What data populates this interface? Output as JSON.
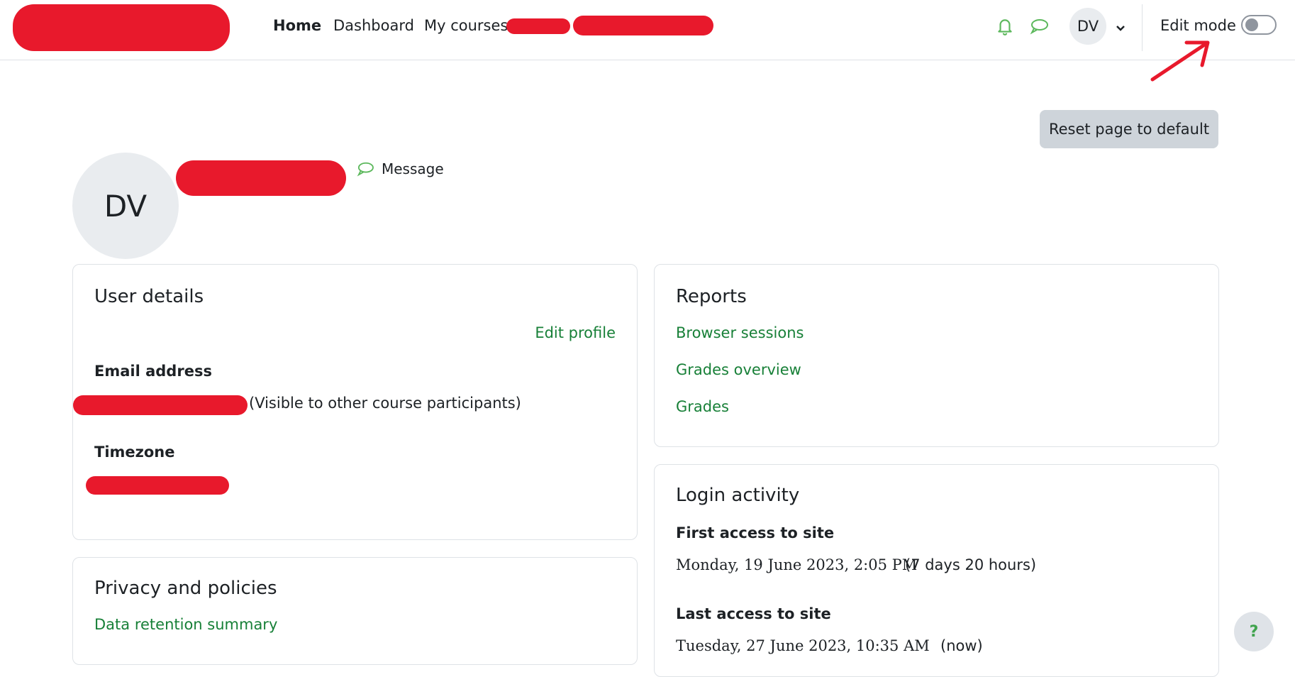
{
  "nav": {
    "items": [
      {
        "label": "Home"
      },
      {
        "label": "Dashboard"
      },
      {
        "label": "My courses"
      }
    ],
    "user_initials": "DV",
    "edit_mode_label": "Edit mode"
  },
  "page": {
    "reset_button": "Reset page to default",
    "avatar_initials": "DV",
    "message_label": "Message"
  },
  "user_details": {
    "title": "User details",
    "edit_profile": "Edit profile",
    "email_label": "Email address",
    "email_note": "(Visible to other course participants)",
    "timezone_label": "Timezone"
  },
  "privacy": {
    "title": "Privacy and policies",
    "link": "Data retention summary"
  },
  "reports": {
    "title": "Reports",
    "links": [
      "Browser sessions",
      "Grades overview",
      "Grades"
    ]
  },
  "login_activity": {
    "title": "Login activity",
    "first_label": "First access to site",
    "first_date": "Monday, 19 June 2023, 2:05 PM",
    "first_rel": "(7 days 20 hours)",
    "last_label": "Last access to site",
    "last_date": "Tuesday, 27 June 2023, 10:35 AM",
    "last_rel": "(now)"
  },
  "help": {
    "label": "?"
  },
  "colors": {
    "link": "#188038",
    "redaction": "#e8192c",
    "accent_icon": "#5cb85c"
  }
}
